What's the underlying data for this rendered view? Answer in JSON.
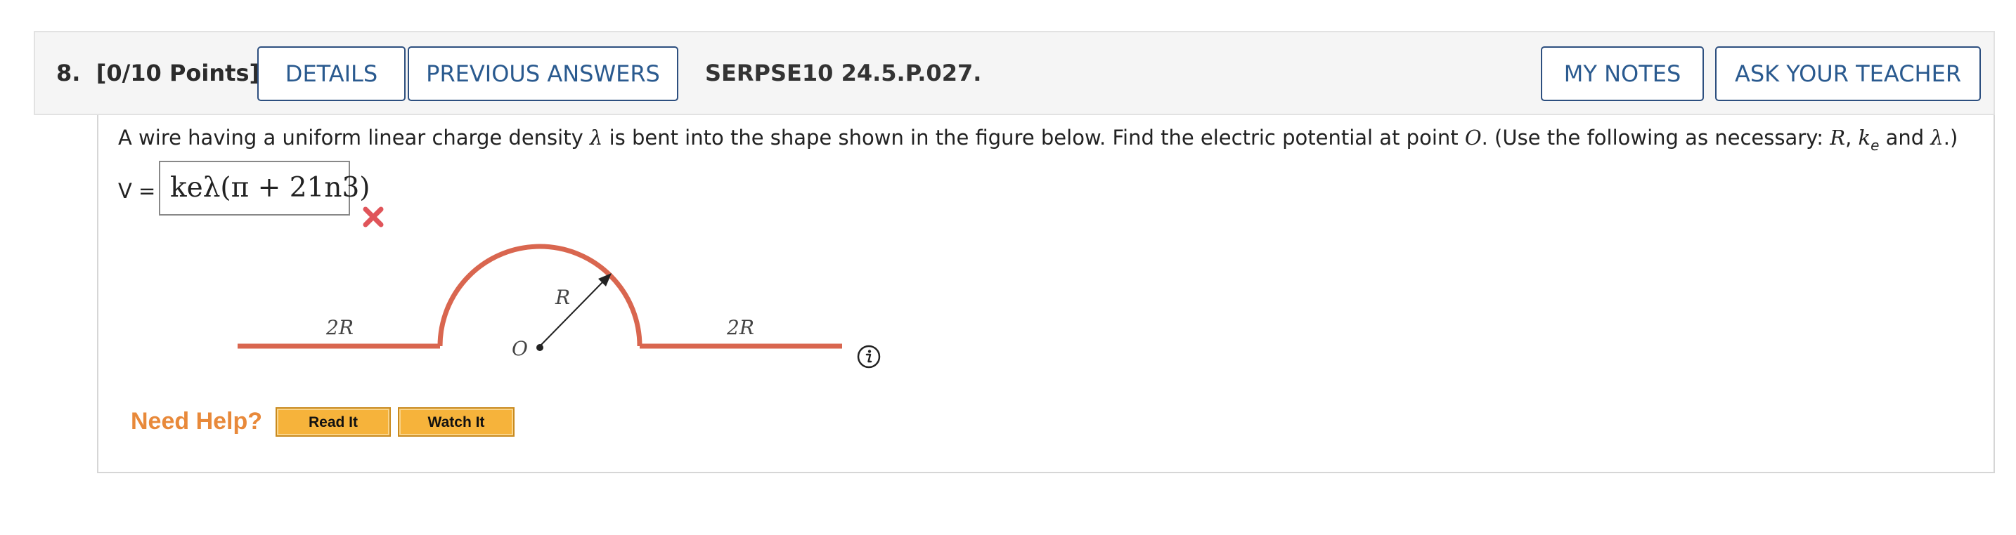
{
  "header": {
    "question_number": "8.",
    "points": "[0/10 Points]",
    "details_label": "DETAILS",
    "previous_answers_label": "PREVIOUS ANSWERS",
    "reference": "SERPSE10 24.5.P.027.",
    "my_notes_label": "MY NOTES",
    "ask_teacher_label": "ASK YOUR TEACHER"
  },
  "question": {
    "text_part1": "A wire having a uniform linear charge density ",
    "lambda": "λ",
    "text_part2": " is bent into the shape shown in the figure below. Find the electric potential at point ",
    "point": "O",
    "text_part3": ". (Use the following as necessary: ",
    "var_R": "R",
    "sep": ", ",
    "var_k": "k",
    "var_k_sub": "e",
    "and_text": " and ",
    "lambda2": "λ",
    "text_end": ".)"
  },
  "answer": {
    "label": "V =",
    "value": "keλ(π + 21n3)",
    "status": "incorrect"
  },
  "figure": {
    "left_label": "2R",
    "right_label": "2R",
    "radius_label": "R",
    "center_label": "O",
    "wire_color": "#d9664f"
  },
  "help": {
    "label": "Need Help?",
    "read_it": "Read It",
    "watch_it": "Watch It"
  }
}
